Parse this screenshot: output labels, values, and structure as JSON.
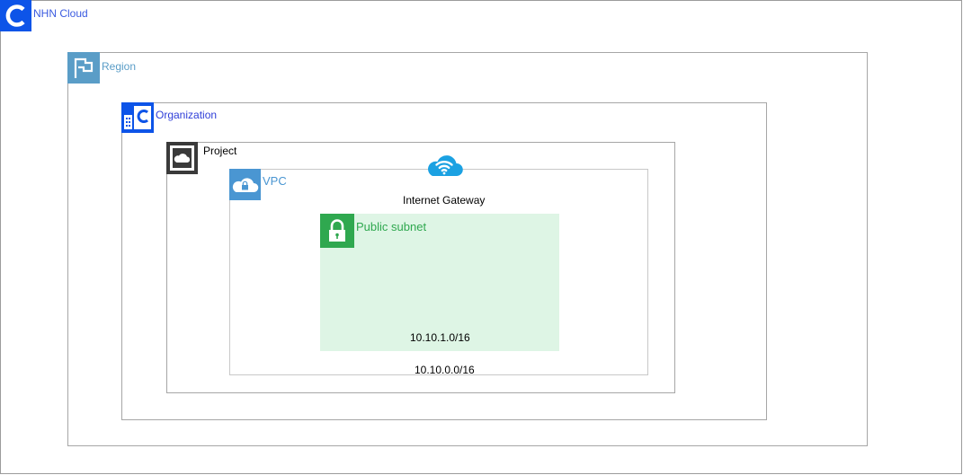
{
  "diagram": {
    "nhn_cloud": {
      "label": "NHN Cloud",
      "icon": "nhn-cloud-logo-icon",
      "color": "#0d54e8"
    },
    "region": {
      "label": "Region",
      "icon": "flag-icon",
      "color": "#5a9dc7"
    },
    "organization": {
      "label": "Organization",
      "icon": "organization-building-icon",
      "color": "#2e3ed8"
    },
    "project": {
      "label": "Project",
      "icon": "project-cloud-icon",
      "color": "#3a3a3a"
    },
    "vpc": {
      "label": "VPC",
      "cidr": "10.10.0.0/16",
      "icon": "cloud-lock-icon",
      "color": "#4a96d2"
    },
    "internet_gateway": {
      "label": "Internet Gateway",
      "icon": "cloud-wifi-icon",
      "color": "#1ba1e2"
    },
    "public_subnet": {
      "label": "Public subnet",
      "cidr": "10.10.1.0/16",
      "icon": "lock-icon",
      "color": "#2fa84f",
      "fill": "#def5e5"
    }
  }
}
